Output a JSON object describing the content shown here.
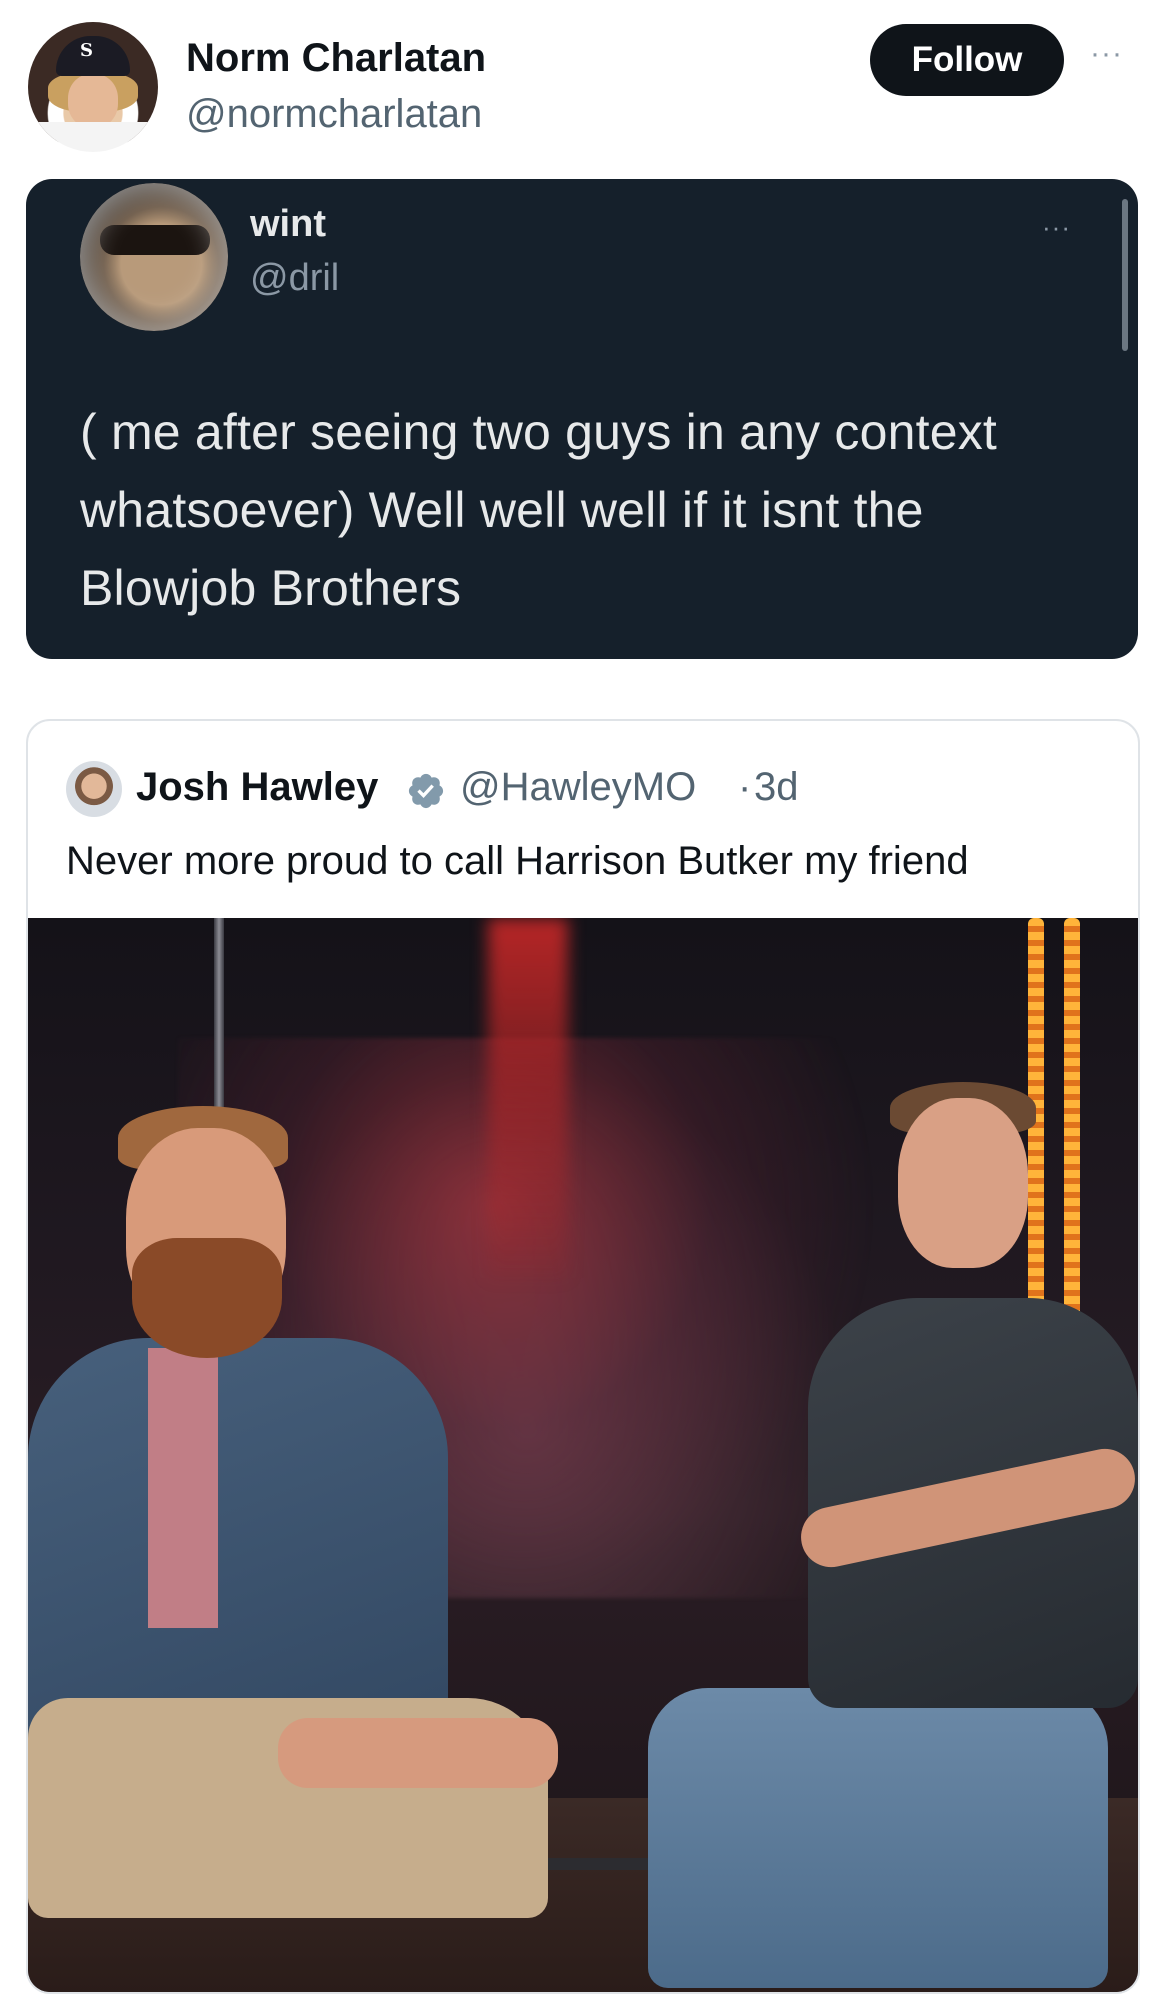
{
  "tweet": {
    "author_name": "Norm Charlatan",
    "author_handle": "@normcharlatan",
    "follow_label": "Follow",
    "more_glyph": "···"
  },
  "embedded_tweet": {
    "author_name": "wint",
    "author_handle": "@dril",
    "more_glyph": "···",
    "text": "( me after seeing two guys in any context whatsoever) Well well well if it isnt the Blowjob Brothers",
    "background_color": "#15202b"
  },
  "quoted_tweet": {
    "author_name": "Josh Hawley",
    "author_handle": "@HawleyMO",
    "separator": "·",
    "timestamp": "3d",
    "verified": true,
    "verified_color": "#829aab",
    "text": "Never more proud to call Harrison Butker my friend",
    "image": "photo-two-men-seated-on-stage"
  },
  "colors": {
    "follow_button_bg": "#0f1419",
    "secondary_text": "#536471"
  }
}
